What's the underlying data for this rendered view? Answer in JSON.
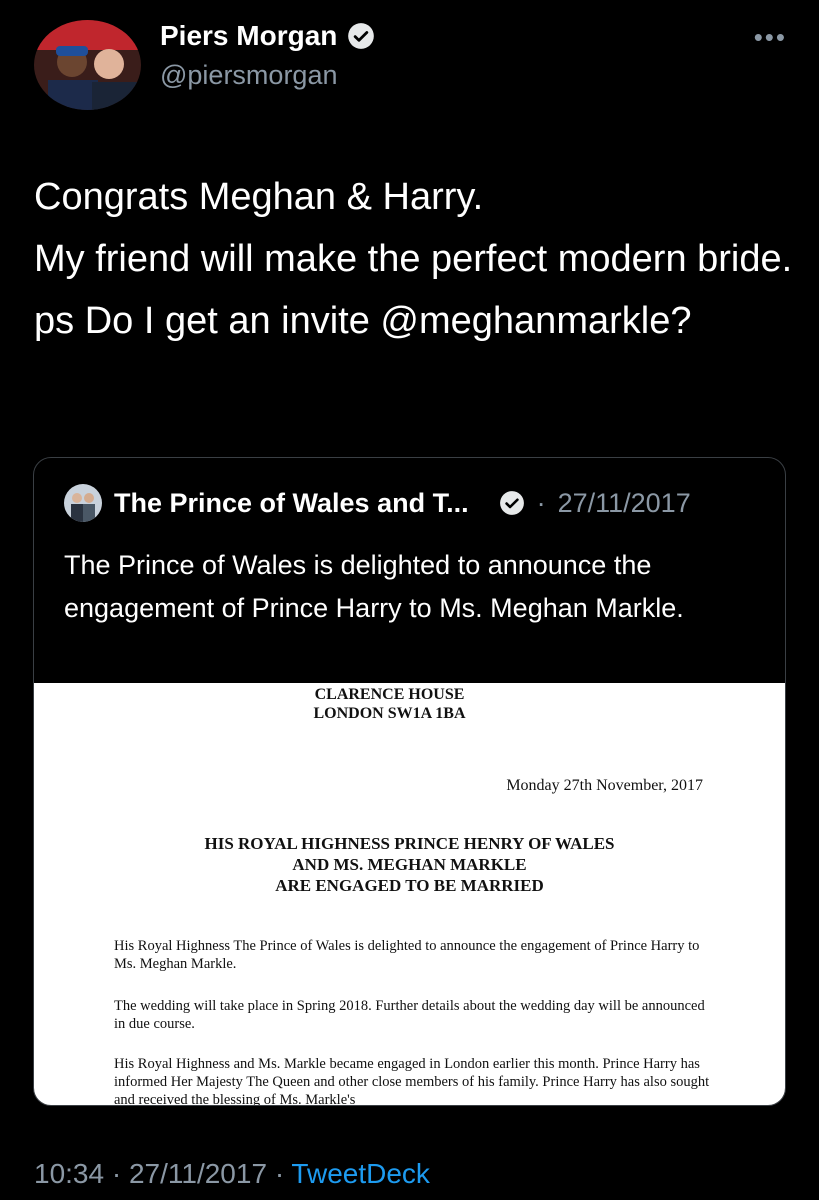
{
  "author": {
    "name": "Piers Morgan",
    "handle": "@piersmorgan",
    "avatar_icon": "profile-photo"
  },
  "menu_icon": "more-options-icon",
  "tweet": {
    "text": "Congrats Meghan & Harry.\nMy friend will make the perfect modern bride.\nps Do I get an invite @meghanmarkle?"
  },
  "quoted": {
    "name": "The Prince of Wales and T...",
    "separator": "·",
    "date": "27/11/2017",
    "text": "The Prince of Wales is delighted to announce the engagement of Prince Harry to Ms. Meghan Markle.",
    "document": {
      "address_line1": "CLARENCE HOUSE",
      "address_line2": "LONDON SW1A 1BA",
      "date": "Monday 27th November, 2017",
      "heading": "HIS ROYAL HIGHNESS PRINCE HENRY OF WALES\nAND MS. MEGHAN MARKLE\nARE ENGAGED TO BE MARRIED",
      "para1": "His Royal Highness The Prince of Wales is delighted to announce the engagement of Prince Harry to Ms. Meghan Markle.",
      "para2": "The wedding will take place in Spring 2018. Further details about the wedding day will be announced in due course.",
      "para3": "His Royal Highness and Ms. Markle became engaged in London earlier this month. Prince Harry has informed Her Majesty The Queen and other close members of his family. Prince Harry has also sought and received the blessing of Ms. Markle's"
    }
  },
  "footer": {
    "time": "10:34",
    "date": "27/11/2017",
    "separator": "·",
    "source": "TweetDeck"
  },
  "colors": {
    "background": "#000000",
    "secondary_text": "#8b98a5",
    "link": "#1d9bf0"
  }
}
